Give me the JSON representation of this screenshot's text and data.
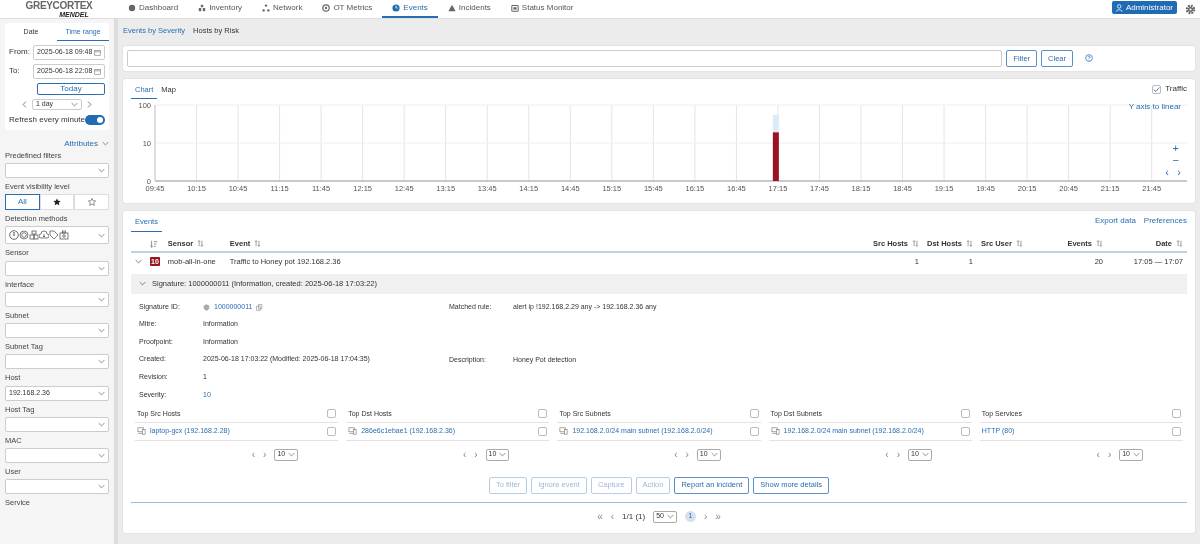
{
  "nav": {
    "logo_top": "GREYCORTEX",
    "logo_bottom": "MENDEL",
    "items": [
      {
        "label": "Dashboard",
        "selected": false
      },
      {
        "label": "Inventory",
        "selected": false
      },
      {
        "label": "Network",
        "selected": false
      },
      {
        "label": "OT Metrics",
        "selected": false
      },
      {
        "label": "Events",
        "selected": true
      },
      {
        "label": "Incidents",
        "selected": false
      },
      {
        "label": "Status Monitor",
        "selected": false
      }
    ],
    "user": "Administrator"
  },
  "sidebar": {
    "time_tabs": [
      {
        "label": "Date",
        "selected": false
      },
      {
        "label": "Time range",
        "selected": true
      }
    ],
    "from_label": "From:",
    "from": "2025-06-18 09:48",
    "to_label": "To:",
    "to": "2025-06-18 22:08",
    "today": "Today",
    "period": "1 day",
    "refresh_label": "Refresh every minute",
    "refresh_on": true,
    "attributes": "Attributes",
    "filters": [
      {
        "kind": "select",
        "label": "Predefined filters"
      },
      {
        "kind": "visibility",
        "label": "Event visibility level",
        "options": [
          {
            "kind": "text",
            "label": "All",
            "selected": true
          },
          {
            "kind": "star",
            "selected": false
          },
          {
            "kind": "star-outline",
            "selected": false
          }
        ]
      },
      {
        "kind": "methods",
        "label": "Detection methods"
      },
      {
        "kind": "select",
        "label": "Sensor"
      },
      {
        "kind": "select",
        "label": "Interface"
      },
      {
        "kind": "select",
        "label": "Subnet"
      },
      {
        "kind": "select",
        "label": "Subnet Tag"
      },
      {
        "kind": "select",
        "label": "Host",
        "value": "192.168.2.36"
      },
      {
        "kind": "select",
        "label": "Host Tag"
      },
      {
        "kind": "select",
        "label": "MAC"
      },
      {
        "kind": "select",
        "label": "User"
      },
      {
        "kind": "label",
        "label": "Service"
      }
    ]
  },
  "subtabs": [
    {
      "label": "Events by Severity",
      "selected": true
    },
    {
      "label": "Hosts by Risk",
      "selected": false
    }
  ],
  "filter_bar": {
    "buttons": [
      "Filter",
      "Clear"
    ]
  },
  "chart_panel": {
    "tabs": [
      {
        "label": "Chart",
        "selected": true
      },
      {
        "label": "Map",
        "selected": false
      }
    ],
    "traffic_label": "Traffic",
    "traffic_checked": true,
    "axis_link": "Y axis to linear",
    "controls": [
      "+",
      "−",
      "‹",
      "›"
    ],
    "y_labels": [
      "100",
      "10",
      "0"
    ],
    "x_labels": [
      "09:45",
      "10:15",
      "10:45",
      "11:15",
      "11:45",
      "12:15",
      "12:45",
      "13:15",
      "13:45",
      "14:15",
      "14:45",
      "15:15",
      "15:45",
      "16:15",
      "16:45",
      "17:15",
      "17:45",
      "18:15",
      "18:45",
      "19:15",
      "19:45",
      "20:15",
      "20:45",
      "21:15",
      "21:45"
    ]
  },
  "events": {
    "tab": "Events",
    "links": [
      "Export data",
      "Preferences"
    ],
    "columns": [
      "Sensor",
      "Event",
      "Src Hosts",
      "Dst Hosts",
      "Src User",
      "Events",
      "Date"
    ],
    "rows": [
      {
        "expanded": true,
        "severity": "10",
        "cells": [
          "mob-all-in-one",
          "Traffic to Honey pot 192.168.2.36",
          "1",
          "1",
          null,
          "20",
          "17:05 — 17:07"
        ]
      }
    ],
    "signature": {
      "title": "Signature: 1000000011 (Information, created: 2025-06-18 17:03:22)",
      "expanded": true,
      "left": [
        {
          "label": "Signature ID:",
          "value": "1000000011",
          "kind": "id"
        },
        {
          "label": "Mitre:",
          "value": "Information"
        },
        {
          "label": "Proofpoint:",
          "value": "Information"
        },
        {
          "label": "Created:",
          "value": "2025-06-18 17:03:22 (Modified: 2025-06-18 17:04:35)"
        },
        {
          "label": "Revision:",
          "value": "1"
        },
        {
          "label": "Severity:",
          "value": "10",
          "kind": "link"
        }
      ],
      "right": [
        {
          "label": "Matched rule:",
          "value": "alert ip !192.168.2.29 any -> 192.168.2.36 any"
        },
        {
          "label": "Description:",
          "value": "Honey Pot detection"
        }
      ]
    },
    "tops": [
      {
        "title": "Top Src Hosts",
        "checked": false,
        "prev": "‹",
        "next": "›",
        "page_size": "10",
        "items": [
          {
            "kind": "host",
            "text": "laptop-gcx (192.168.2.28)",
            "checked": false
          }
        ]
      },
      {
        "title": "Top Dst Hosts",
        "checked": false,
        "prev": "‹",
        "next": "›",
        "page_size": "10",
        "items": [
          {
            "kind": "host",
            "text": "286e6c1ebae1 (192.168.2.36)",
            "checked": false
          }
        ]
      },
      {
        "title": "Top Src Subnets",
        "checked": false,
        "prev": "‹",
        "next": "›",
        "page_size": "10",
        "items": [
          {
            "kind": "host",
            "text": "192.168.2.0/24 main subnet (192.168.2.0/24)",
            "checked": false
          }
        ]
      },
      {
        "title": "Top Dst Subnets",
        "checked": false,
        "prev": "‹",
        "next": "›",
        "page_size": "10",
        "items": [
          {
            "kind": "host",
            "text": "192.168.2.0/24 main subnet (192.168.2.0/24)",
            "checked": false
          }
        ]
      },
      {
        "title": "Top Services",
        "checked": false,
        "prev": "‹",
        "next": "›",
        "page_size": "10",
        "items": [
          {
            "kind": "service",
            "text": "HTTP (80)",
            "checked": false
          }
        ]
      }
    ],
    "actions": [
      {
        "label": "To filter",
        "disabled": true
      },
      {
        "label": "Ignore event",
        "disabled": true
      },
      {
        "label": "Capture",
        "disabled": true
      },
      {
        "label": "Action",
        "disabled": true
      },
      {
        "label": "Report an incident",
        "disabled": false
      },
      {
        "label": "Show more details",
        "disabled": false
      }
    ],
    "pagination": {
      "first": "«",
      "prev": "‹",
      "info": "1/1 (1)",
      "page_size": "50",
      "pages": [
        {
          "label": "1",
          "selected": true
        }
      ],
      "next": "›",
      "last": "»"
    }
  }
}
